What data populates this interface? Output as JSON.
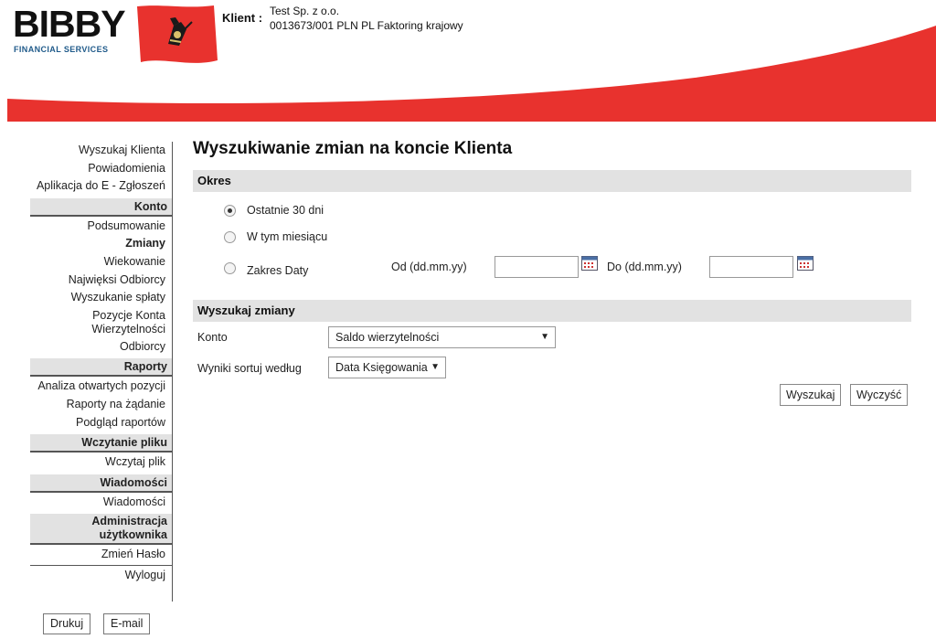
{
  "header": {
    "logo_text": "BIBBY",
    "logo_subtext": "FINANCIAL SERVICES",
    "client_label": "Klient :",
    "client_name": "Test Sp. z o.o.",
    "client_account": "0013673/001 PLN PL Faktoring krajowy",
    "brand_red": "#e8322e"
  },
  "nav": {
    "top_items": [
      "Wyszukaj Klienta",
      "Powiadomienia",
      "Aplikacja do E - Zgłoszeń"
    ],
    "konto": {
      "title": "Konto",
      "items": [
        "Podsumowanie",
        "Zmiany",
        "Wiekowanie",
        "Najwięksi Odbiorcy",
        "Wyszukanie spłaty",
        "Pozycje Konta Wierzytelności",
        "Odbiorcy"
      ]
    },
    "raporty": {
      "title": "Raporty",
      "items": [
        "Analiza otwartych pozycji",
        "Raporty na żądanie",
        "Podgląd raportów"
      ]
    },
    "wczytanie": {
      "title": "Wczytanie pliku",
      "items": [
        "Wczytaj plik"
      ]
    },
    "wiadomosci": {
      "title": "Wiadomości",
      "items": [
        "Wiadomości"
      ]
    },
    "admin": {
      "title": "Administracja użytkownika",
      "items": [
        "Zmień Hasło",
        "Wyloguj"
      ]
    }
  },
  "bottom_buttons": {
    "print": "Drukuj",
    "email": "E-mail"
  },
  "main": {
    "title": "Wyszukiwanie zmian na koncie Klienta",
    "period": {
      "header": "Okres",
      "option_last30": "Ostatnie 30 dni",
      "option_month": "W tym miesiącu",
      "option_range": "Zakres Daty",
      "from_label": "Od (dd.mm.yy)",
      "to_label": "Do (dd.mm.yy)",
      "from_value": "",
      "to_value": "",
      "selected": "Ostatnie 30 dni"
    },
    "search": {
      "header": "Wyszukaj zmiany",
      "account_label": "Konto",
      "account_value": "Saldo wierzytelności",
      "sort_label": "Wyniki sortuj według",
      "sort_value": "Data Księgowania",
      "search_button": "Wyszukaj",
      "clear_button": "Wyczyść"
    }
  }
}
